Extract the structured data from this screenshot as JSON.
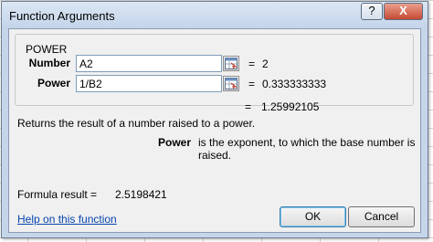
{
  "dialog": {
    "title": "Function Arguments",
    "help_button": "?",
    "close_button": "X"
  },
  "function": {
    "name": "POWER",
    "args": [
      {
        "label": "Number",
        "value": "A2",
        "eq": "=",
        "result": "2"
      },
      {
        "label": "Power",
        "value": "1/B2",
        "eq": "=",
        "result": "0.333333333"
      }
    ],
    "result_eq": "=",
    "result": "1.25992105",
    "description": "Returns the result of a number raised to a power.",
    "arg_help_name": "Power",
    "arg_help_text": "is the exponent, to which the base number is raised."
  },
  "formula_result": {
    "label": "Formula result =",
    "value": "2.5198421"
  },
  "help_link": "Help on this function",
  "buttons": {
    "ok": "OK",
    "cancel": "Cancel"
  }
}
